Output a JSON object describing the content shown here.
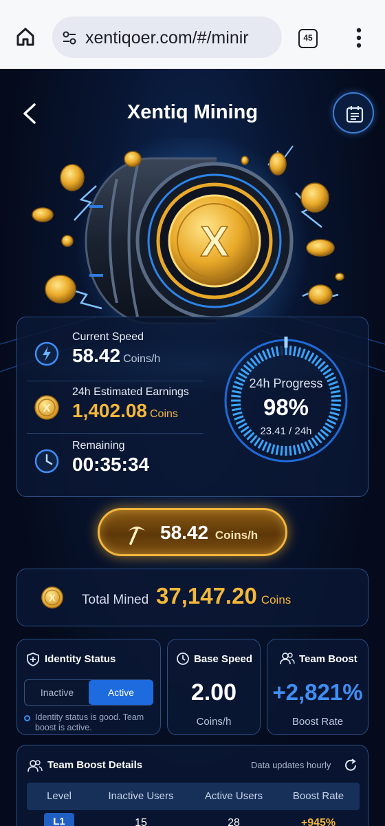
{
  "browser": {
    "url": "xentiqoer.com/#/minir",
    "tab_count": "45"
  },
  "header": {
    "title": "Xentiq Mining"
  },
  "stats": {
    "current_speed": {
      "label": "Current Speed",
      "value": "58.42",
      "unit": "Coins/h"
    },
    "estimated_earnings": {
      "label": "24h Estimated Earnings",
      "value": "1,402.08",
      "unit": "Coins"
    },
    "remaining": {
      "label": "Remaining",
      "value": "00:35:34"
    },
    "progress": {
      "label": "24h Progress",
      "percent": "98%",
      "fraction": 0.98,
      "detail": "23.41 / 24h"
    }
  },
  "mine_button": {
    "value": "58.42",
    "unit": "Coins/h"
  },
  "total_mined": {
    "label": "Total Mined",
    "value": "37,147.20",
    "unit": "Coins"
  },
  "identity": {
    "title": "Identity Status",
    "options": [
      "Inactive",
      "Active"
    ],
    "selected": "Active",
    "note": "Identity status is good. Team boost is active."
  },
  "base_speed": {
    "title": "Base Speed",
    "value": "2.00",
    "unit": "Coins/h"
  },
  "team_boost": {
    "title": "Team Boost",
    "value": "+2,821%",
    "sub": "Boost Rate"
  },
  "team_details": {
    "title": "Team Boost Details",
    "note": "Data updates hourly",
    "columns": [
      "Level",
      "Inactive Users",
      "Active Users",
      "Boost Rate"
    ],
    "rows": [
      {
        "level": "L1",
        "inactive": "15",
        "active": "28",
        "boost": "+945%"
      }
    ]
  },
  "colors": {
    "gold": "#f4b73a",
    "accent_blue": "#1e6be0",
    "panel_border": "#2b4f86"
  }
}
